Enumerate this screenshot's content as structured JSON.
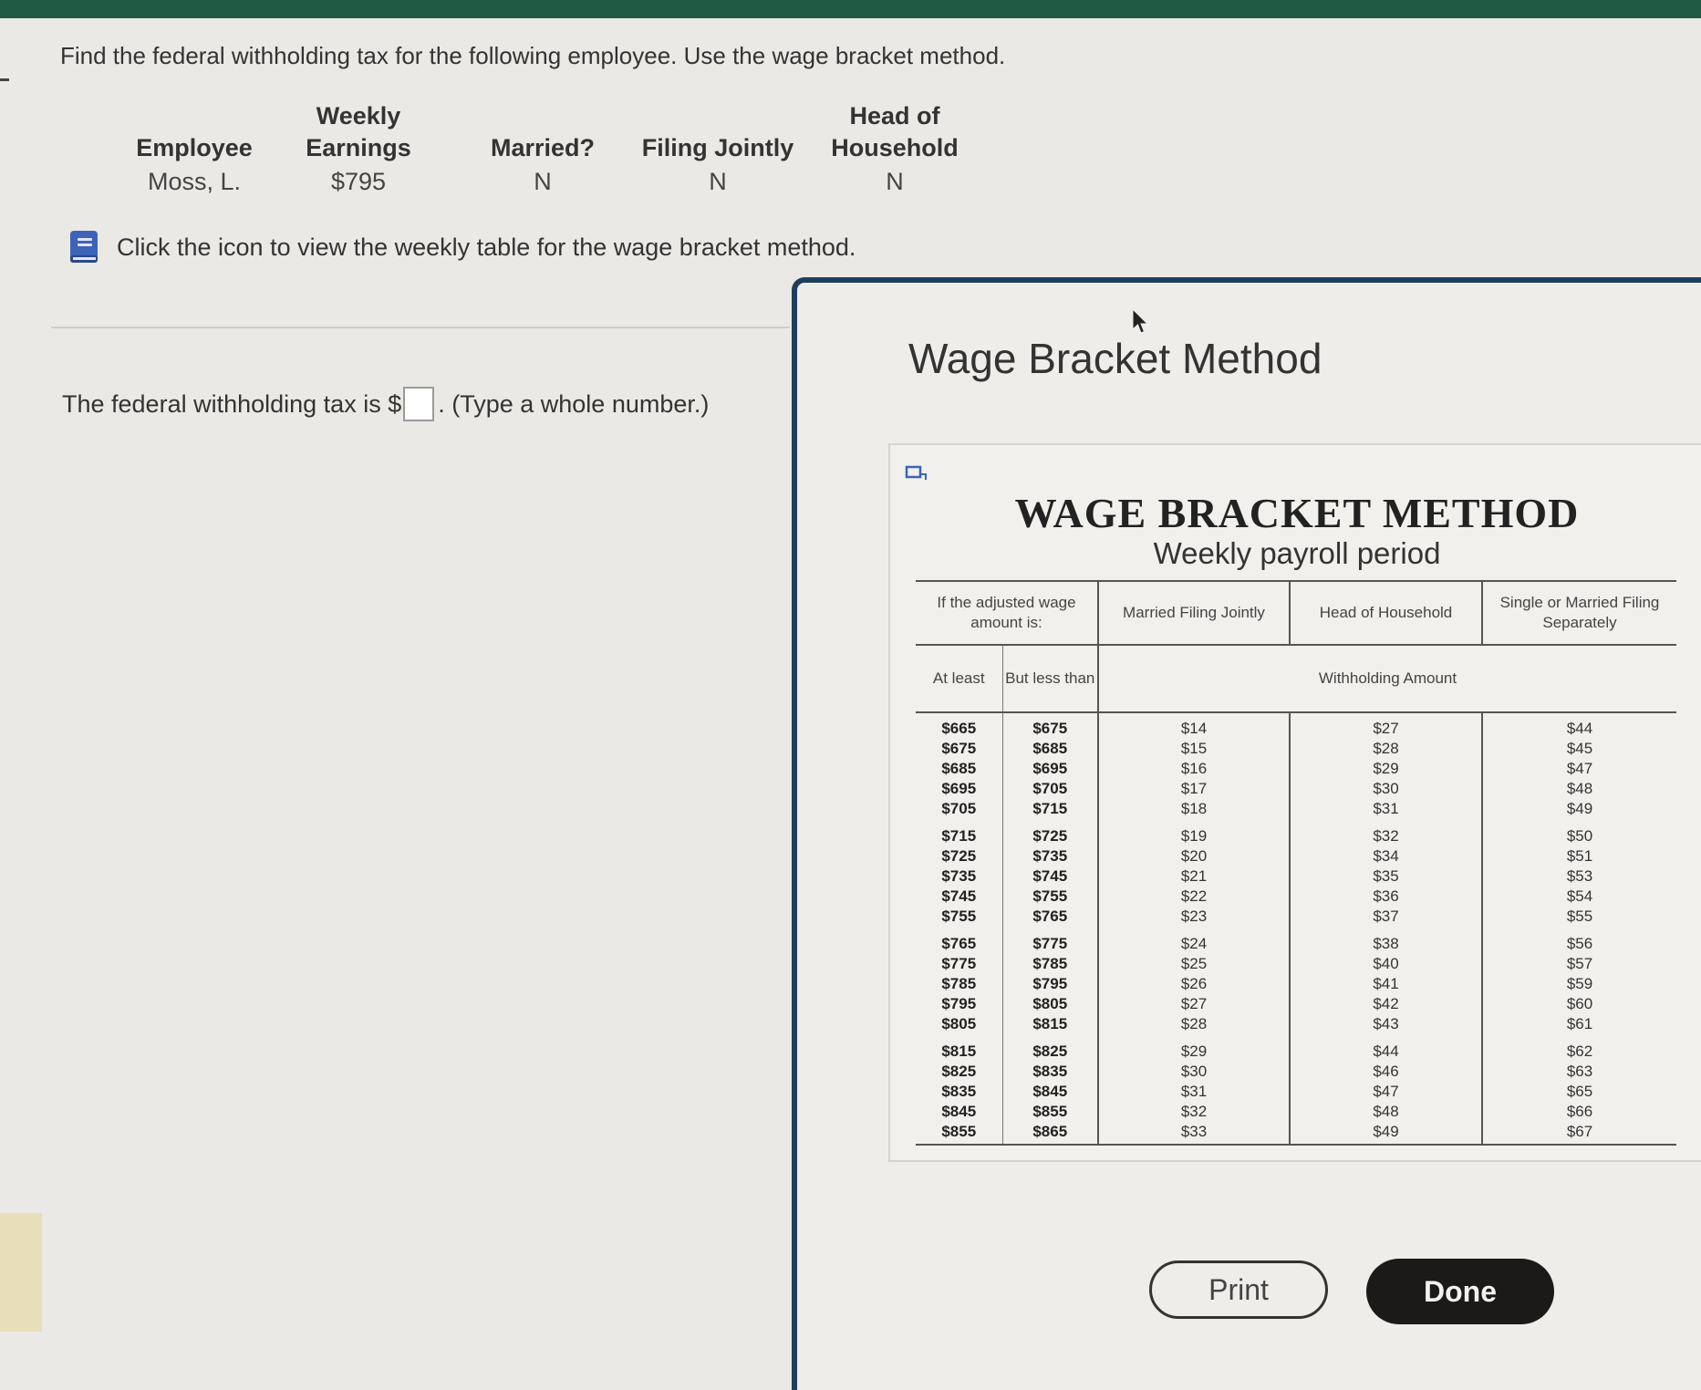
{
  "question": {
    "instruction": "Find the federal withholding tax for the following employee. Use the wage bracket method.",
    "columns": [
      {
        "header_line1": "",
        "header_line2": "Employee",
        "value": "Moss, L."
      },
      {
        "header_line1": "Weekly",
        "header_line2": "Earnings",
        "value": "$795"
      },
      {
        "header_line1": "",
        "header_line2": "Married?",
        "value": "N"
      },
      {
        "header_line1": "",
        "header_line2": "Filing Jointly",
        "value": "N"
      },
      {
        "header_line1": "Head of",
        "header_line2": "Household",
        "value": "N"
      }
    ],
    "icon_prompt": "Click the icon to view the weekly table for the wage bracket method.",
    "answer_prefix": "The federal withholding tax is $",
    "answer_value": "",
    "answer_suffix": ". (Type a whole number.)"
  },
  "dialog": {
    "title": "Wage Bracket Method",
    "table_title": "WAGE BRACKET METHOD",
    "table_subtitle": "Weekly payroll period",
    "headers": {
      "wage_range": "If the adjusted wage amount is:",
      "married_jointly": "Married Filing Jointly",
      "head_of_household": "Head of Household",
      "single": "Single or Married Filing Separately",
      "at_least": "At least",
      "but_less_than": "But less than",
      "withholding_amount": "Withholding Amount"
    },
    "rows": [
      [
        "$665",
        "$675",
        "$14",
        "$27",
        "$44"
      ],
      [
        "$675",
        "$685",
        "$15",
        "$28",
        "$45"
      ],
      [
        "$685",
        "$695",
        "$16",
        "$29",
        "$47"
      ],
      [
        "$695",
        "$705",
        "$17",
        "$30",
        "$48"
      ],
      [
        "$705",
        "$715",
        "$18",
        "$31",
        "$49"
      ],
      [
        "$715",
        "$725",
        "$19",
        "$32",
        "$50"
      ],
      [
        "$725",
        "$735",
        "$20",
        "$34",
        "$51"
      ],
      [
        "$735",
        "$745",
        "$21",
        "$35",
        "$53"
      ],
      [
        "$745",
        "$755",
        "$22",
        "$36",
        "$54"
      ],
      [
        "$755",
        "$765",
        "$23",
        "$37",
        "$55"
      ],
      [
        "$765",
        "$775",
        "$24",
        "$38",
        "$56"
      ],
      [
        "$775",
        "$785",
        "$25",
        "$40",
        "$57"
      ],
      [
        "$785",
        "$795",
        "$26",
        "$41",
        "$59"
      ],
      [
        "$795",
        "$805",
        "$27",
        "$42",
        "$60"
      ],
      [
        "$805",
        "$815",
        "$28",
        "$43",
        "$61"
      ],
      [
        "$815",
        "$825",
        "$29",
        "$44",
        "$62"
      ],
      [
        "$825",
        "$835",
        "$30",
        "$46",
        "$63"
      ],
      [
        "$835",
        "$845",
        "$31",
        "$47",
        "$65"
      ],
      [
        "$845",
        "$855",
        "$32",
        "$48",
        "$66"
      ],
      [
        "$855",
        "$865",
        "$33",
        "$49",
        "$67"
      ]
    ],
    "print_label": "Print",
    "done_label": "Done"
  },
  "icons": {
    "book": "book-icon",
    "expand": "expand-icon",
    "cursor": "mouse-cursor-icon"
  },
  "colors": {
    "top_bar": "#1f5a44",
    "dialog_border": "#1d3f5e",
    "book_icon": "#3d63b8",
    "done_button": "#1c1a19"
  }
}
